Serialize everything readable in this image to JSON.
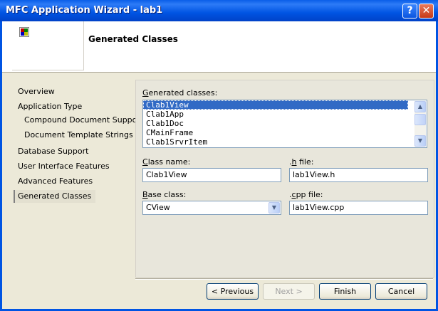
{
  "window": {
    "title": "MFC Application Wizard - lab1",
    "help_label": "?",
    "close_label": "✕"
  },
  "header": {
    "heading": "Generated Classes"
  },
  "nav": [
    {
      "label": "Overview"
    },
    {
      "label": "Application Type"
    },
    {
      "label": "Compound Document Support"
    },
    {
      "label": "Document Template Strings"
    },
    {
      "label": "Database Support"
    },
    {
      "label": "User Interface Features"
    },
    {
      "label": "Advanced Features"
    },
    {
      "label": "Generated Classes"
    }
  ],
  "classes": {
    "label_first": "G",
    "label_rest": "enerated classes:",
    "items": [
      "Clab1View",
      "Clab1App",
      "Clab1Doc",
      "CMainFrame",
      "Clab1SrvrItem"
    ],
    "selected": "Clab1View"
  },
  "class_name": {
    "label_first": "C",
    "label_rest": "lass name:",
    "value": "Clab1View"
  },
  "h_file": {
    "label_pre": ".",
    "label_first": "h",
    "label_rest": " file:",
    "value": "lab1View.h"
  },
  "base_class": {
    "label_first": "B",
    "label_rest": "ase class:",
    "value": "CView"
  },
  "cpp_file": {
    "label_pre": ".",
    "label_first": "c",
    "label_rest": "pp file:",
    "value": "lab1View.cpp"
  },
  "buttons": {
    "previous": "< Previous",
    "next": "Next >",
    "finish": "Finish",
    "cancel": "Cancel"
  },
  "colors": {
    "title_bar": "#0054e3",
    "selection": "#316ac5",
    "dialog_bg": "#ece9d8"
  }
}
